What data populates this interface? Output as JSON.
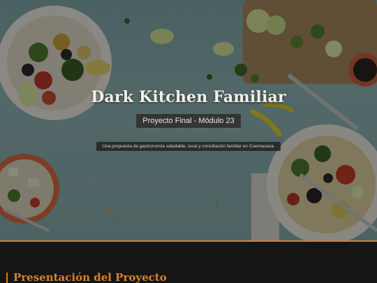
{
  "hero": {
    "title": "Dark Kitchen Familiar",
    "badge": "Proyecto Final - Módulo 23",
    "tagline": "Una propuesta de gastronomía saludable, local y conciliación familiar en Cuernavaca."
  },
  "section": {
    "title": "Presentación del Proyecto"
  },
  "colors": {
    "accent": "#d4822e",
    "background": "#161514"
  }
}
